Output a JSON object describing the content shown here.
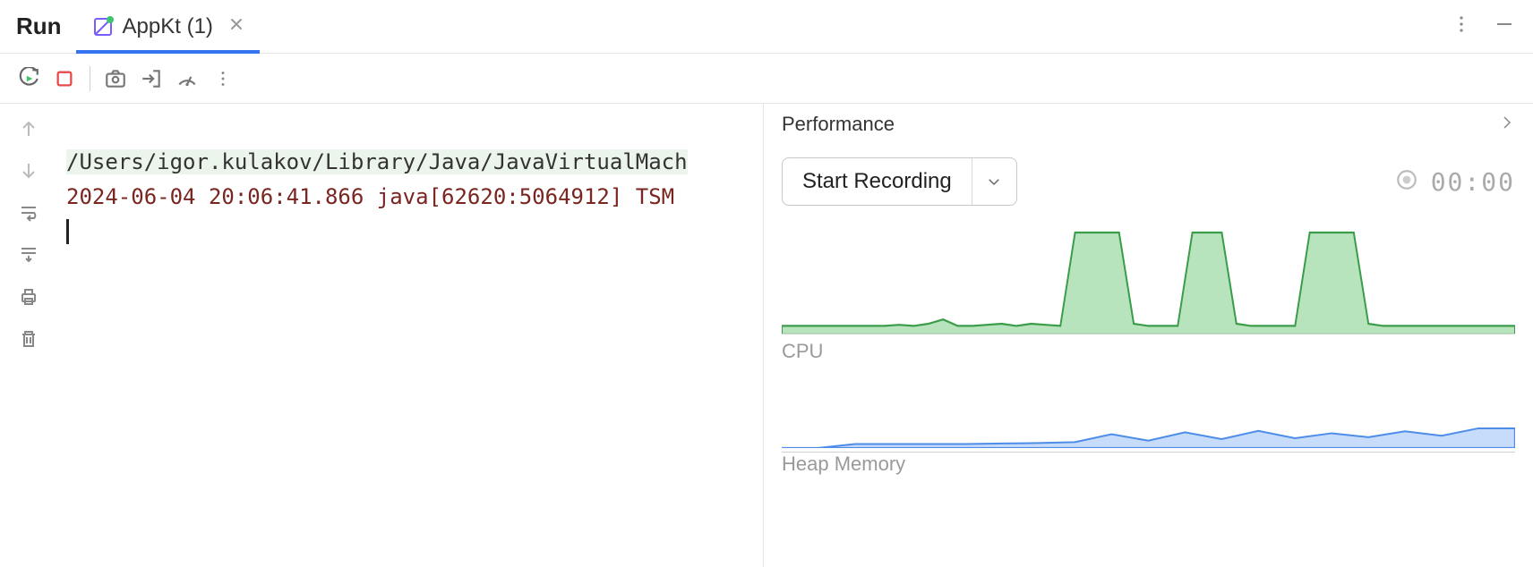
{
  "tabs": {
    "panel_title": "Run",
    "active": {
      "label": "AppKt (1)"
    }
  },
  "console": {
    "line1": "/Users/igor.kulakov/Library/Java/JavaVirtualMach",
    "line2": "2024-06-04 20:06:41.866 java[62620:5064912] TSM"
  },
  "performance": {
    "title": "Performance",
    "record_button": "Start Recording",
    "timer": "00:00",
    "cpu_label": "CPU",
    "heap_label": "Heap Memory"
  },
  "chart_data": [
    {
      "type": "area",
      "name": "CPU",
      "xlabel": "",
      "ylabel": "",
      "ylim": [
        0,
        100
      ],
      "x": [
        0,
        2,
        4,
        6,
        8,
        10,
        12,
        14,
        16,
        18,
        20,
        22,
        24,
        26,
        28,
        30,
        32,
        34,
        36,
        38,
        40,
        42,
        44,
        46,
        48,
        50,
        52,
        54,
        56,
        58,
        60,
        62,
        64,
        66,
        68,
        70,
        72,
        74,
        76,
        78,
        80,
        82,
        84,
        86,
        88,
        90,
        92,
        94,
        96,
        98,
        100
      ],
      "values": [
        8,
        8,
        8,
        8,
        8,
        8,
        8,
        8,
        9,
        8,
        10,
        14,
        8,
        8,
        9,
        10,
        8,
        10,
        9,
        8,
        95,
        95,
        95,
        95,
        10,
        8,
        8,
        8,
        95,
        95,
        95,
        10,
        8,
        8,
        8,
        8,
        95,
        95,
        95,
        95,
        10,
        8,
        8,
        8,
        8,
        8,
        8,
        8,
        8,
        8,
        8
      ],
      "color": "#3b9c4a"
    },
    {
      "type": "area",
      "name": "Heap Memory",
      "xlabel": "",
      "ylabel": "",
      "ylim": [
        0,
        100
      ],
      "x": [
        0,
        5,
        10,
        15,
        20,
        25,
        30,
        35,
        40,
        45,
        50,
        55,
        60,
        65,
        70,
        75,
        80,
        85,
        90,
        95,
        100
      ],
      "values": [
        0,
        0,
        8,
        8,
        8,
        8,
        9,
        10,
        12,
        28,
        15,
        32,
        18,
        35,
        20,
        30,
        22,
        34,
        25,
        40,
        40
      ],
      "color": "#4d8de8"
    }
  ]
}
